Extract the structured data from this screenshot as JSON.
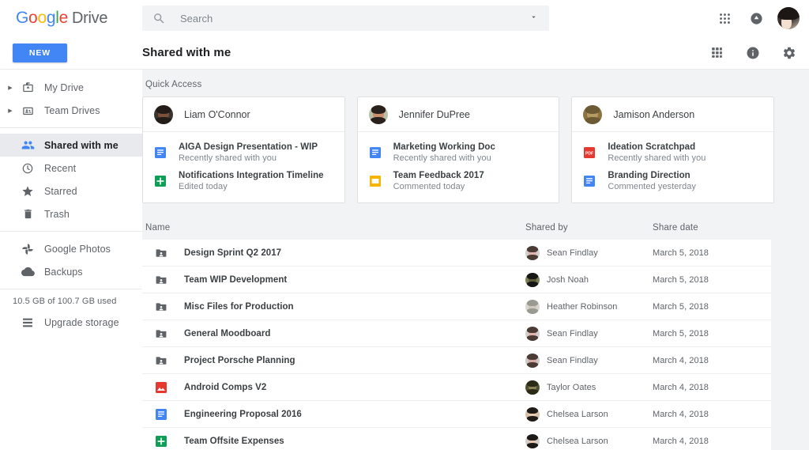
{
  "brand": {
    "g1": "G",
    "o1": "o",
    "o2": "o",
    "g2": "g",
    "l": "l",
    "e": "e",
    "product": "Drive"
  },
  "search": {
    "placeholder": "Search",
    "value": ""
  },
  "topbar_icons": [
    {
      "name": "apps-grid-icon",
      "label": "Google apps"
    },
    {
      "name": "notifications-icon",
      "label": "Notifications"
    },
    {
      "name": "account-avatar",
      "label": "Account"
    }
  ],
  "subbar": {
    "new_label": "NEW",
    "title": "Shared with me",
    "icons": [
      {
        "name": "grid-view-icon",
        "label": "Grid view"
      },
      {
        "name": "info-icon",
        "label": "Details"
      },
      {
        "name": "settings-gear-icon",
        "label": "Settings"
      }
    ]
  },
  "sidebar": {
    "items": [
      {
        "label": "My Drive",
        "icon": "my-drive-icon",
        "expandable": true,
        "active": false
      },
      {
        "label": "Team Drives",
        "icon": "team-drives-icon",
        "expandable": true,
        "active": false
      },
      {
        "label": "Shared with me",
        "icon": "people-icon",
        "expandable": false,
        "active": true
      },
      {
        "label": "Recent",
        "icon": "clock-icon",
        "expandable": false,
        "active": false
      },
      {
        "label": "Starred",
        "icon": "star-icon",
        "expandable": false,
        "active": false
      },
      {
        "label": "Trash",
        "icon": "trash-icon",
        "expandable": false,
        "active": false
      },
      {
        "label": "Google Photos",
        "icon": "photos-pinwheel-icon",
        "expandable": false,
        "active": false
      },
      {
        "label": "Backups",
        "icon": "cloud-icon",
        "expandable": false,
        "active": false
      }
    ],
    "storage_text": "10.5 GB of 100.7 GB used",
    "upgrade_label": "Upgrade storage",
    "upgrade_icon": "storage-bars-icon"
  },
  "quick_access": {
    "label": "Quick Access",
    "cards": [
      {
        "person": "Liam O'Connor",
        "avatar_colors": {
          "hair": "#241c18",
          "skin": "#7a5139",
          "bg": "#3b3330"
        },
        "files": [
          {
            "title": "AIGA Design Presentation - WIP",
            "subtitle": "Recently shared with you",
            "icon": "google-docs-icon"
          },
          {
            "title": "Notifications Integration Timeline",
            "subtitle": "Edited today",
            "icon": "google-sheets-icon"
          }
        ]
      },
      {
        "person": "Jennifer DuPree",
        "avatar_colors": {
          "hair": "#2a211c",
          "skin": "#c98f6e",
          "bg": "#b9c0a8"
        },
        "files": [
          {
            "title": "Marketing Working Doc",
            "subtitle": "Recently shared with you",
            "icon": "google-docs-icon"
          },
          {
            "title": "Team Feedback 2017",
            "subtitle": "Commented today",
            "icon": "google-slides-icon"
          }
        ]
      },
      {
        "person": "Jamison Anderson",
        "avatar_colors": {
          "hair": "#6b5a33",
          "skin": "#b59a63",
          "bg": "#8a7340"
        },
        "files": [
          {
            "title": "Ideation Scratchpad",
            "subtitle": "Recently shared with you",
            "icon": "pdf-icon"
          },
          {
            "title": "Branding Direction",
            "subtitle": "Commented yesterday",
            "icon": "google-docs-icon"
          }
        ]
      }
    ]
  },
  "table": {
    "columns": {
      "name": "Name",
      "shared_by": "Shared by",
      "share_date": "Share date"
    },
    "rows": [
      {
        "name": "Design Sprint Q2 2017",
        "icon": "shared-folder-icon",
        "shared_by": "Sean Findlay",
        "date": "March 5, 2018",
        "avatar": {
          "hair": "#4a3b34",
          "skin": "#e2b2ad",
          "bg": "#cfcfcf"
        }
      },
      {
        "name": "Team WIP Development",
        "icon": "shared-folder-icon",
        "shared_by": "Josh Noah",
        "date": "March 5, 2018",
        "avatar": {
          "hair": "#161616",
          "skin": "#5e5a3a",
          "bg": "#7a7f54"
        }
      },
      {
        "name": "Misc Files for Production",
        "icon": "shared-folder-icon",
        "shared_by": "Heather Robinson",
        "date": "March 5, 2018",
        "avatar": {
          "hair": "#9a9a92",
          "skin": "#cfc8bc",
          "bg": "#d8d6cf"
        }
      },
      {
        "name": "General Moodboard",
        "icon": "shared-folder-icon",
        "shared_by": "Sean Findlay",
        "date": "March 5, 2018",
        "avatar": {
          "hair": "#4a3b34",
          "skin": "#e2b2ad",
          "bg": "#cfcfcf"
        }
      },
      {
        "name": "Project Porsche Planning",
        "icon": "shared-folder-icon",
        "shared_by": "Sean Findlay",
        "date": "March 4, 2018",
        "avatar": {
          "hair": "#4a3b34",
          "skin": "#d9a9a2",
          "bg": "#c9c9c9"
        }
      },
      {
        "name": "Android Comps V2",
        "icon": "image-file-icon",
        "shared_by": "Taylor Oates",
        "date": "March 4, 2018",
        "avatar": {
          "hair": "#2b2a16",
          "skin": "#8d8256",
          "bg": "#4e5230"
        }
      },
      {
        "name": "Engineering Proposal 2016",
        "icon": "google-docs-icon",
        "shared_by": "Chelsea Larson",
        "date": "March 4, 2018",
        "avatar": {
          "hair": "#1f1b19",
          "skin": "#e9cbb4",
          "bg": "#d6c0ab"
        }
      },
      {
        "name": "Team Offsite Expenses",
        "icon": "google-sheets-icon",
        "shared_by": "Chelsea Larson",
        "date": "March 4, 2018",
        "avatar": {
          "hair": "#1c1917",
          "skin": "#e6c6ae",
          "bg": "#cfcfcf"
        }
      }
    ]
  },
  "colors": {
    "accent": "#4285f4",
    "docs": "#4285f4",
    "sheets": "#0f9d58",
    "slides": "#f4b400",
    "pdf": "#e5392f",
    "image": "#e5392f",
    "folder": "#5f6368",
    "bg": "#f1f3f4"
  }
}
